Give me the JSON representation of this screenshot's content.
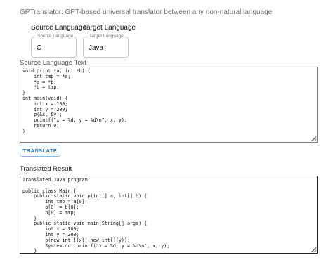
{
  "header": {
    "title": "GPTranslator: GPT-based universal translator between any non-natural language"
  },
  "source_language": {
    "column_label": "Source Language",
    "field_label": "Source Language",
    "value": "C"
  },
  "target_language": {
    "column_label": "Target Language",
    "field_label": "Target Language",
    "value": "Java"
  },
  "source_text": {
    "label": "Source Language Text",
    "value": "void p(int *a, int *b) {\n    int tmp = *a;\n    *a = *b;\n    *b = tmp;\n}\nint main(void) {\n    int x = 100;\n    int y = 200;\n    p(&x, &y);\n    printf(\"x = %d, y = %d\\n\", x, y);\n    return 0;\n}"
  },
  "actions": {
    "translate_label": "TRANSLATE"
  },
  "result": {
    "label": "Translated Result",
    "value": "Translated Java program:\n\npublic class Main {\n    public static void p(int[] a, int[] b) {\n        int tmp = a[0];\n        a[0] = b[0];\n        b[0] = tmp;\n    }\n    public static void main(String[] args) {\n        int x = 100;\n        int y = 200;\n        p(new int[]{x}, new int[]{y});\n        System.out.printf(\"x = %d, y = %d\\n\", x, y);\n    }\n}"
  }
}
